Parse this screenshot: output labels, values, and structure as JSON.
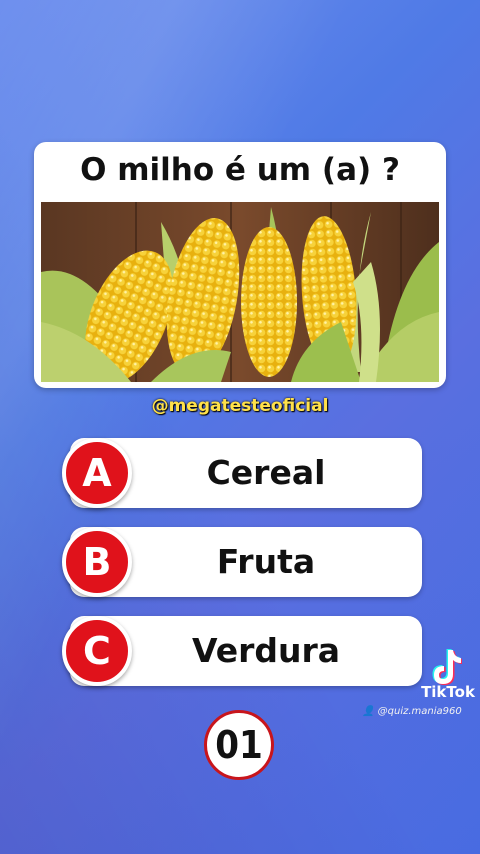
{
  "question": "O milho é um (a) ?",
  "handle": "@megatesteoficial",
  "options": [
    {
      "letter": "A",
      "label": "Cereal"
    },
    {
      "letter": "B",
      "label": "Fruta"
    },
    {
      "letter": "C",
      "label": "Verdura"
    }
  ],
  "question_number": "01",
  "tiktok": {
    "brand": "TikTok",
    "user": "@quiz.mania960"
  },
  "colors": {
    "accent": "#e0121b",
    "handle": "#ffe14a",
    "corn": "#f2c21b"
  },
  "icons": {
    "tiktok": "tiktok-note-icon",
    "user": "user-icon"
  }
}
